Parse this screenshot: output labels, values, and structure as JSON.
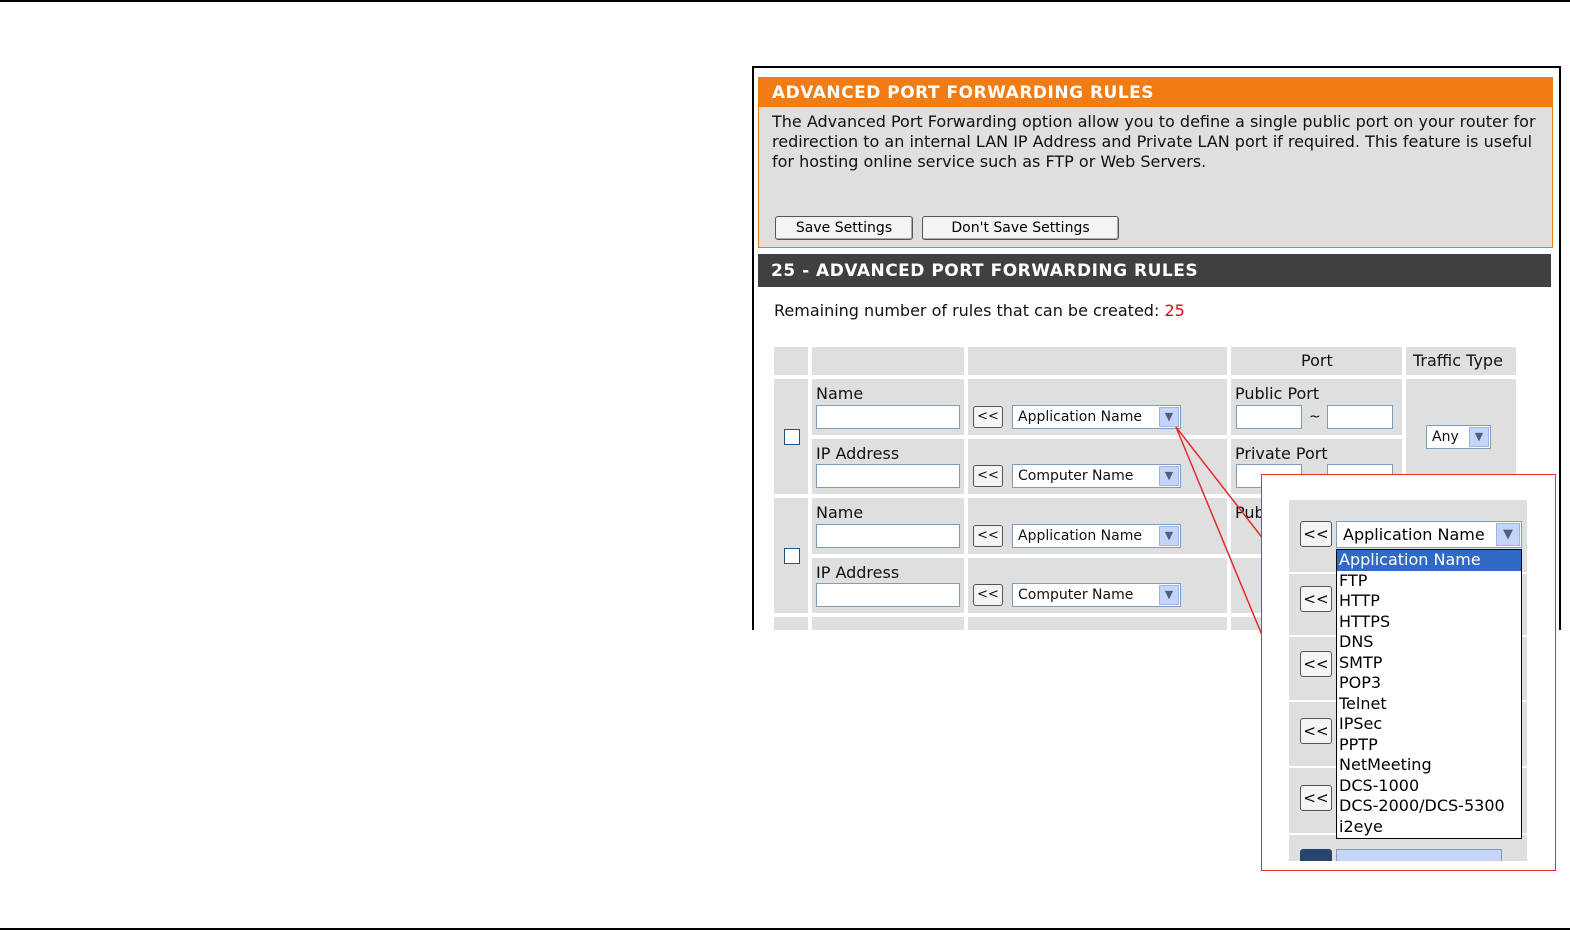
{
  "advanced": {
    "title": "ADVANCED PORT FORWARDING RULES",
    "description": "The Advanced Port Forwarding option allow you to define a single public port on your router for redirection to an internal LAN IP Address and Private LAN port if required. This feature is useful for hosting online service such as FTP or Web Servers.",
    "save_button": "Save Settings",
    "dont_save_button": "Don't Save Settings"
  },
  "rules": {
    "title": "25 - ADVANCED PORT FORWARDING RULES",
    "remaining_label": "Remaining number of rules that can be created:",
    "remaining_count": "25",
    "headers": {
      "port": "Port",
      "traffic_type": "Traffic Type"
    },
    "row1": {
      "name_label": "Name",
      "ip_label": "IP Address",
      "arrow_button": "<<",
      "application_select": "Application Name",
      "computer_select": "Computer Name",
      "public_port_label": "Public Port",
      "private_port_label": "Private Port",
      "tilde": "~",
      "traffic_select": "Any"
    },
    "row2": {
      "name_label": "Name",
      "ip_label": "IP Address",
      "arrow_button": "<<",
      "application_select": "Application Name",
      "computer_select": "Computer Name",
      "public_port_label_partial": "Pub"
    }
  },
  "callout": {
    "arrow_button": "<<",
    "selected_value": "Application Name",
    "options": [
      "Application Name",
      "FTP",
      "HTTP",
      "HTTPS",
      "DNS",
      "SMTP",
      "POP3",
      "Telnet",
      "IPSec",
      "PPTP",
      "NetMeeting",
      "DCS-1000",
      "DCS-2000/DCS-5300",
      "i2eye"
    ],
    "highlighted_option_index": 0
  },
  "colors": {
    "orange_header": "#f07c13",
    "dark_header": "#404040",
    "panel_gray": "#dfdfdf",
    "remaining_red": "#cc1111",
    "callout_red": "#e52b2b",
    "highlight_blue": "#316ac5"
  },
  "icons": {
    "dropdown_arrow": "chevron-down-icon",
    "checkbox": "checkbox-icon"
  }
}
